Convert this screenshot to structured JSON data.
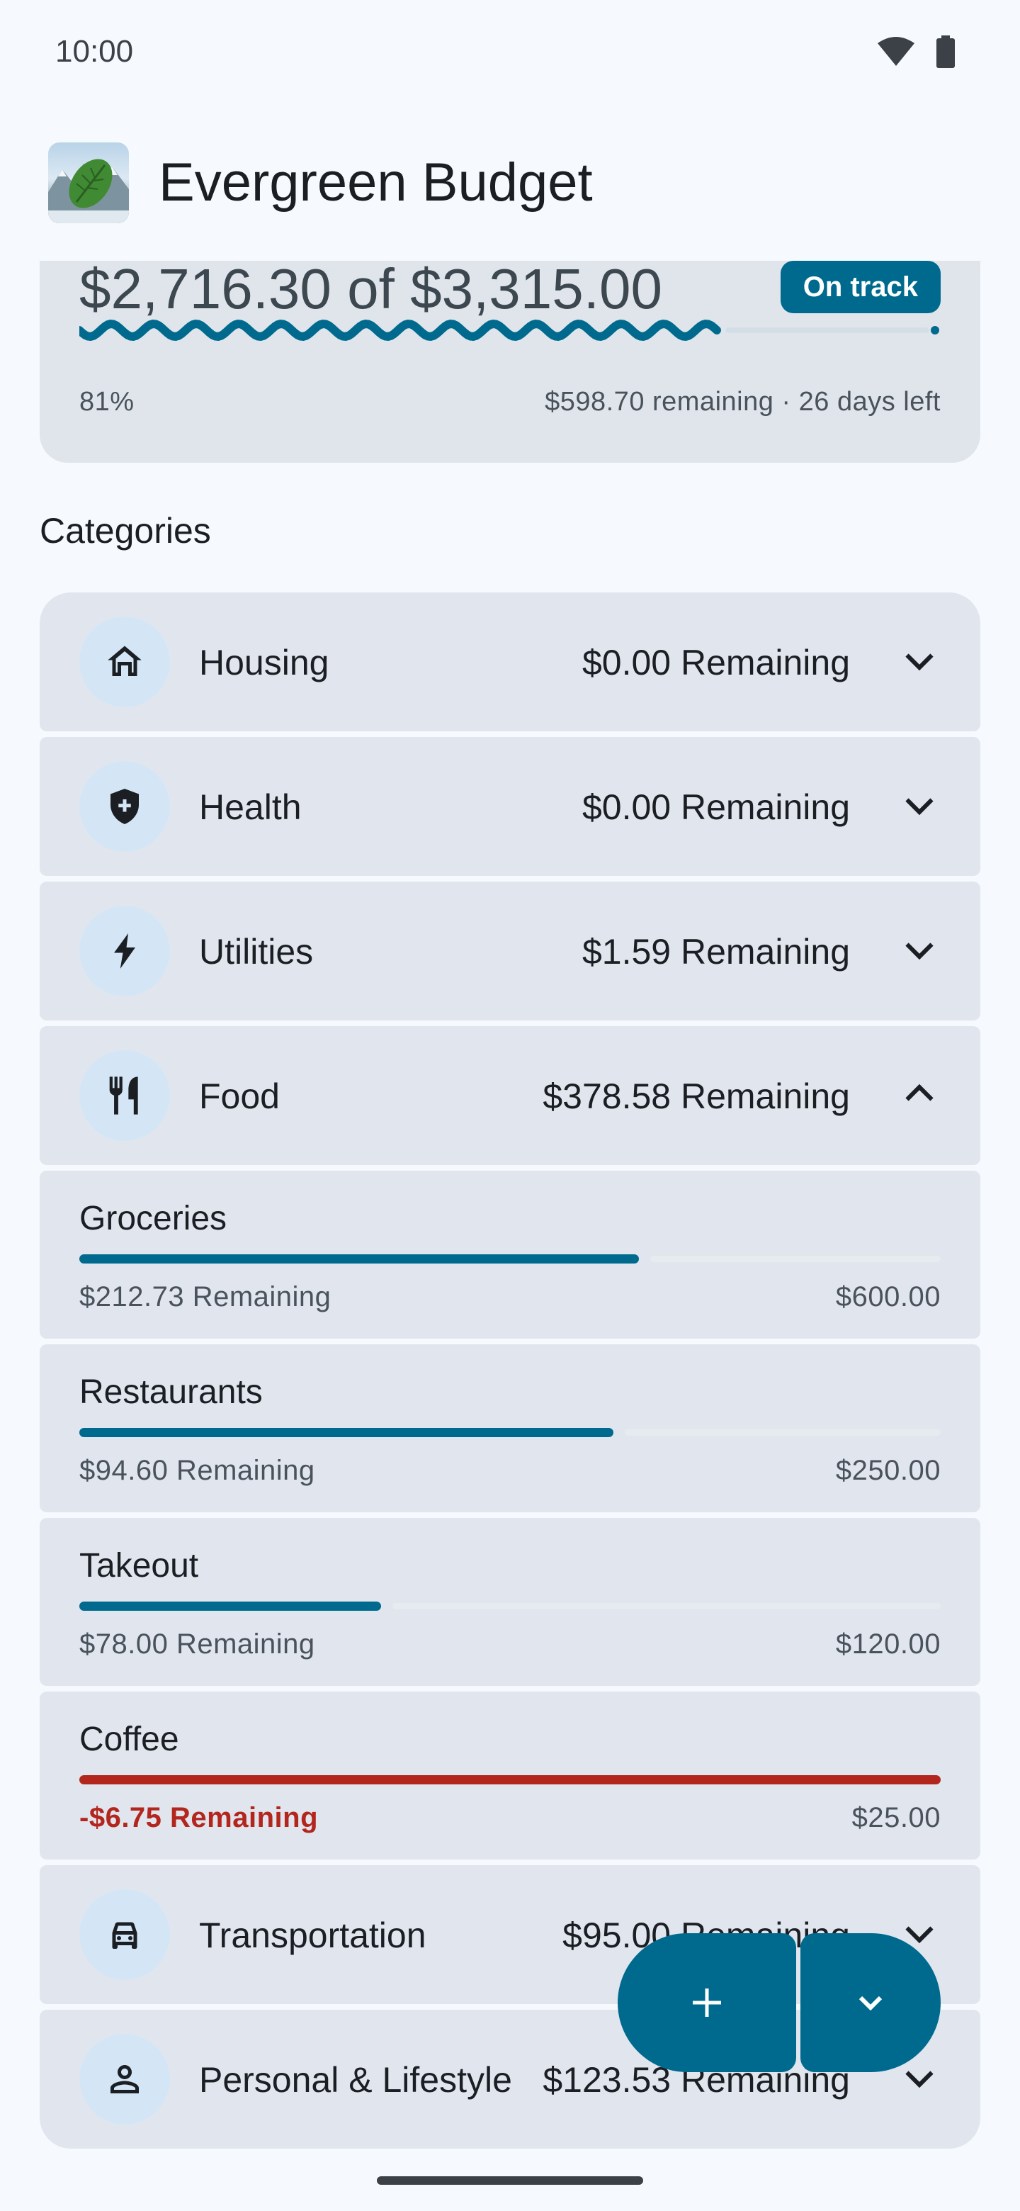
{
  "status_bar": {
    "time": "10:00",
    "icons": [
      "wifi-icon",
      "battery-icon"
    ]
  },
  "app_bar": {
    "title": "Evergreen Budget",
    "logo": "evergreen-leaf-logo"
  },
  "summary": {
    "amount_text": "$2,716.30 of $3,315.00",
    "badge": "On track",
    "percent": "81%",
    "progress": 0.81,
    "meta": "$598.70 remaining · 26 days left"
  },
  "section_title": "Categories",
  "categories": [
    {
      "name": "Housing",
      "remaining": "$0.00 Remaining",
      "icon": "home-icon",
      "expanded": false
    },
    {
      "name": "Health",
      "remaining": "$0.00 Remaining",
      "icon": "shield-plus-icon",
      "expanded": false
    },
    {
      "name": "Utilities",
      "remaining": "$1.59 Remaining",
      "icon": "bolt-icon",
      "expanded": false
    },
    {
      "name": "Food",
      "remaining": "$378.58 Remaining",
      "icon": "utensils-icon",
      "expanded": true
    },
    {
      "name": "Transportation",
      "remaining": "$95.00 Remaining",
      "icon": "car-icon",
      "expanded": false
    },
    {
      "name": "Personal & Lifestyle",
      "remaining": "$123.53 Remaining",
      "icon": "person-icon",
      "expanded": false
    }
  ],
  "food_subcategories": [
    {
      "name": "Groceries",
      "remaining": "$212.73 Remaining",
      "budget": "$600.00",
      "spent_fraction": 0.65,
      "over": false
    },
    {
      "name": "Restaurants",
      "remaining": "$94.60 Remaining",
      "budget": "$250.00",
      "spent_fraction": 0.62,
      "over": false
    },
    {
      "name": "Takeout",
      "remaining": "$78.00 Remaining",
      "budget": "$120.00",
      "spent_fraction": 0.35,
      "over": false
    },
    {
      "name": "Coffee",
      "remaining": "-$6.75 Remaining",
      "budget": "$25.00",
      "spent_fraction": 1.0,
      "over": true
    }
  ],
  "colors": {
    "accent": "#006a8e",
    "over_budget": "#b3261e",
    "card": "#e1e6ee",
    "background": "#f6f9fd"
  },
  "fab": {
    "add_icon": "plus-icon",
    "menu_icon": "chevron-down-icon"
  }
}
